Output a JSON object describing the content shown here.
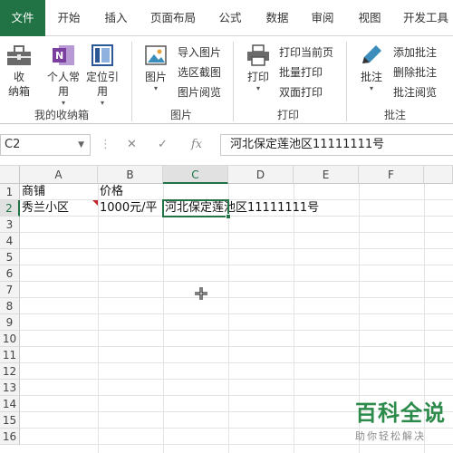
{
  "tabs": [
    "文件",
    "开始",
    "插入",
    "页面布局",
    "公式",
    "数据",
    "审阅",
    "视图",
    "开发工具"
  ],
  "ribbon": {
    "collection": {
      "shoucang": "收\n纳箱",
      "geren": "个人常\n用",
      "dingwei": "定位引\n用",
      "label": "我的收纳箱"
    },
    "picture": {
      "big": "图片",
      "import": "导入图片",
      "screenshot": "选区截图",
      "browse": "图片阅览",
      "label": "图片"
    },
    "print": {
      "big": "打印",
      "current": "打印当前页",
      "batch": "批量打印",
      "duplex": "双面打印",
      "label": "打印"
    },
    "comment": {
      "big": "批注",
      "add": "添加批注",
      "delete": "删除批注",
      "browse": "批注阅览",
      "label": "批注"
    }
  },
  "formula_bar": {
    "name_box": "C2",
    "fx": "fx",
    "content": "河北保定莲池区11111111号"
  },
  "columns": [
    "A",
    "B",
    "C",
    "D",
    "E",
    "F"
  ],
  "rows": [
    "1",
    "2",
    "3",
    "4",
    "5",
    "6",
    "7",
    "8",
    "9",
    "10",
    "11",
    "12",
    "13",
    "14",
    "15",
    "16"
  ],
  "cells": {
    "A1": "商铺",
    "B1": "价格",
    "A2": "秀兰小区",
    "B2": "1000元/平",
    "C2": "河北保定莲池区11111111号"
  },
  "active_cell": "C2",
  "watermark": {
    "title": "百科全说",
    "subtitle": "助你轻松解决"
  },
  "colors": {
    "accent": "#217346",
    "comment": "#c0282d",
    "watermark": "#2c8a4a"
  }
}
